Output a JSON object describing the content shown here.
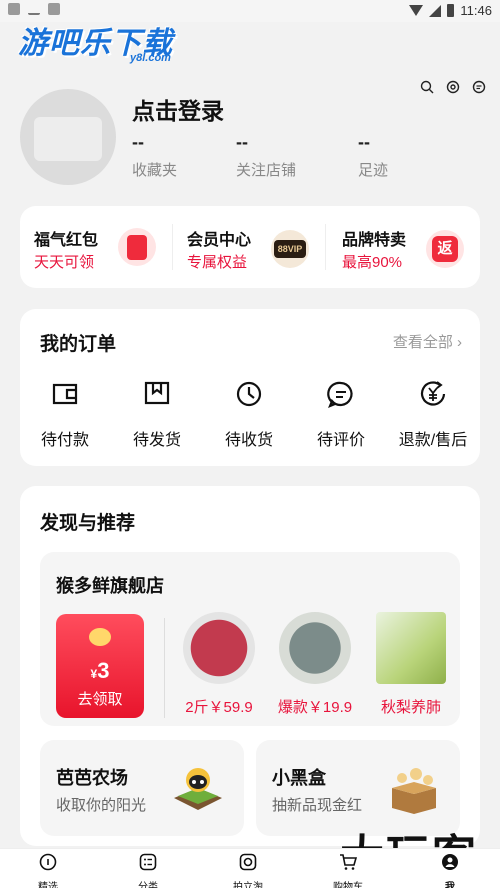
{
  "status_bar": {
    "time": "11:46"
  },
  "watermark": {
    "logo_text": "游吧乐下载",
    "logo_sub": "y8l.com",
    "corner_text": "大玩客"
  },
  "profile": {
    "login_text": "点击登录",
    "stats": [
      {
        "value": "--",
        "label": "收藏夹"
      },
      {
        "value": "--",
        "label": "关注店铺"
      },
      {
        "value": "--",
        "label": "足迹"
      }
    ]
  },
  "promos": [
    {
      "title": "福气红包",
      "subtitle": "天天可领",
      "icon": "red-packet-icon"
    },
    {
      "title": "会员中心",
      "subtitle": "专属权益",
      "icon": "vip-badge-icon",
      "badge": "88VIP"
    },
    {
      "title": "品牌特卖",
      "subtitle": "最高90%",
      "icon": "rebate-icon",
      "badge": "返"
    }
  ],
  "orders": {
    "title": "我的订单",
    "see_all": "查看全部 ›",
    "items": [
      {
        "label": "待付款",
        "icon": "wallet-icon"
      },
      {
        "label": "待发货",
        "icon": "bookmark-box-icon"
      },
      {
        "label": "待收货",
        "icon": "clock-icon"
      },
      {
        "label": "待评价",
        "icon": "comment-icon"
      },
      {
        "label": "退款/售后",
        "icon": "refund-yen-icon"
      }
    ]
  },
  "discover": {
    "title": "发现与推荐",
    "store": {
      "name": "猴多鲜旗舰店",
      "coupon_currency": "¥",
      "coupon_amount": "3",
      "coupon_button": "去领取",
      "products": [
        {
          "label": "2斤￥59.9"
        },
        {
          "label": "爆款￥19.9"
        },
        {
          "label": "秋梨养肺"
        }
      ]
    },
    "cards": [
      {
        "title": "芭芭农场",
        "subtitle": "收取你的阳光"
      },
      {
        "title": "小黑盒",
        "subtitle": "抽新品现金红"
      }
    ]
  },
  "tabs": [
    {
      "label": "精选",
      "icon": "home-icon"
    },
    {
      "label": "分类",
      "icon": "category-icon"
    },
    {
      "label": "拍立淘",
      "icon": "camera-icon"
    },
    {
      "label": "购物车",
      "icon": "cart-icon"
    },
    {
      "label": "我",
      "icon": "profile-icon"
    }
  ]
}
